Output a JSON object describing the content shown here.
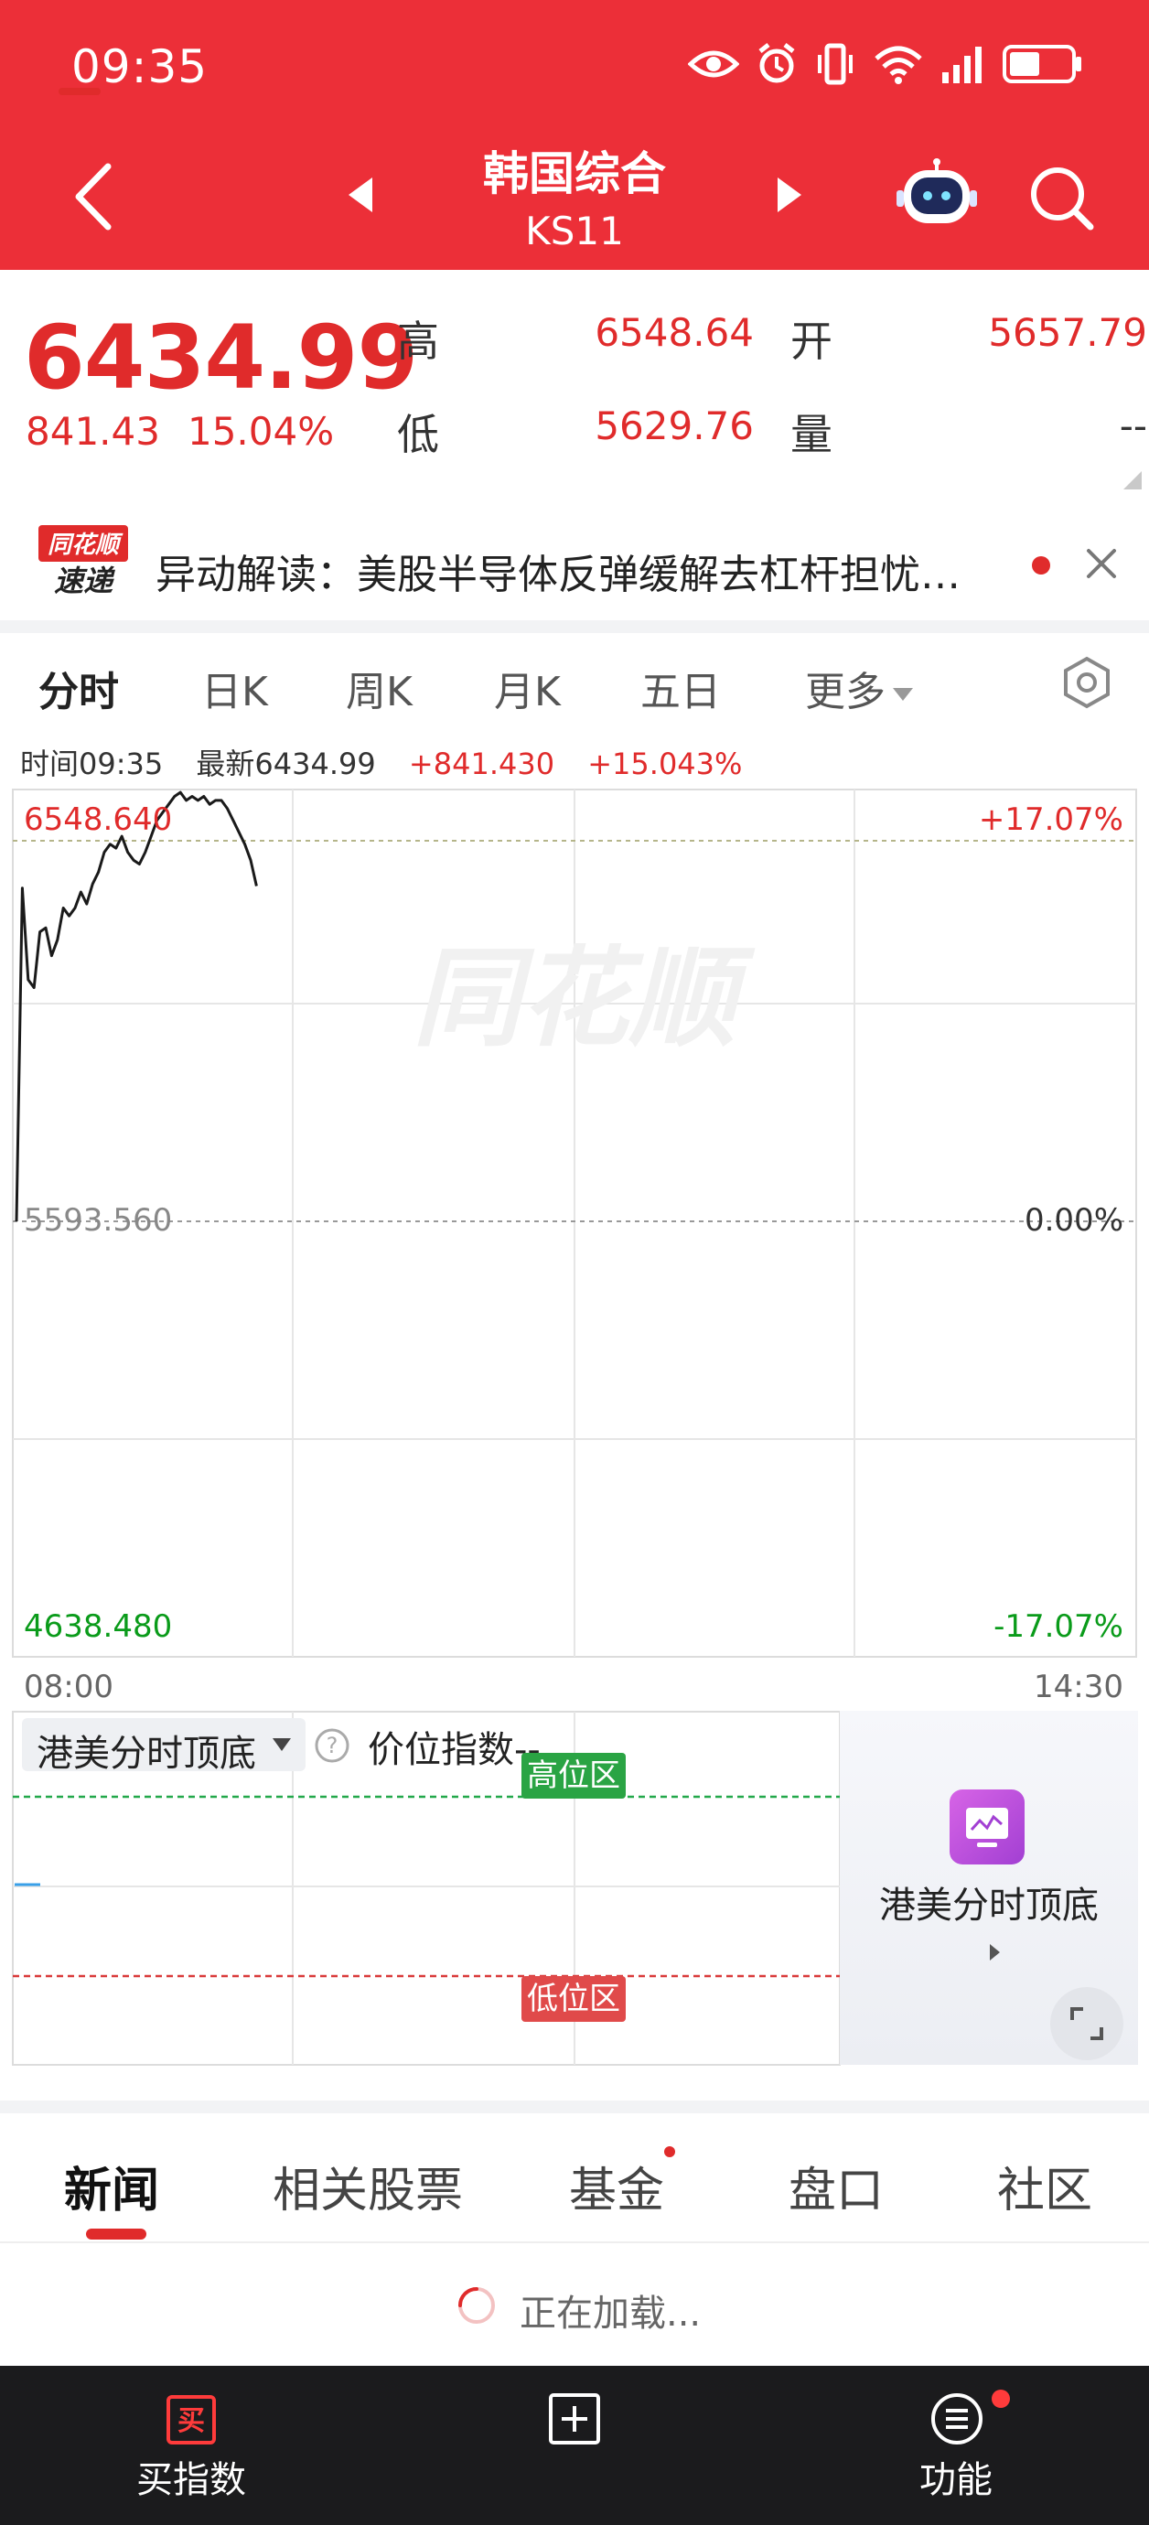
{
  "status_bar": {
    "time": "09:35",
    "battery_level": 0.5
  },
  "header": {
    "title": "韩国综合",
    "code": "KS11"
  },
  "quote": {
    "price": "6434.99",
    "change": "841.43",
    "change_pct": "15.04%",
    "high_label": "高",
    "high": "6548.64",
    "open_label": "开",
    "open": "5657.79",
    "low_label": "低",
    "low": "5629.76",
    "volume_label": "量",
    "volume": "--",
    "colors": {
      "up": "#e02b2b",
      "down": "#0a9b1a",
      "brand": "#ec2f38"
    }
  },
  "ticker": {
    "logo_top": "同花顺",
    "logo_bottom": "速递",
    "text": "异动解读：美股半导体反弹缓解去杠杆担忧…"
  },
  "chart_tabs": [
    "分时",
    "日K",
    "周K",
    "月K",
    "五日",
    "更多"
  ],
  "chart_info": {
    "time_label": "时间",
    "time": "09:35",
    "latest_label": "最新",
    "latest": "6434.99",
    "change": "+841.430",
    "change_pct": "+15.043%"
  },
  "chart_data": {
    "type": "line",
    "series": [
      {
        "values": [
          5593.56,
          6430.0,
          6200.0,
          6180.0,
          6320.0,
          6330.0,
          6260.0,
          6300.0,
          6380.0,
          6360.0,
          6380.0,
          6420.0,
          6390.0,
          6440.0,
          6470.0,
          6520.0,
          6540.0,
          6530.0,
          6560.0,
          6520.0,
          6500.0,
          6490.0,
          6520.0,
          6560.0,
          6600.0,
          6620.0,
          6640.0,
          6660.0,
          6670.0,
          6650.0,
          6660.0,
          6650.0,
          6660.0,
          6640.0,
          6650.0,
          6650.0,
          6630.0,
          6600.0,
          6570.0,
          6540.0,
          6500.0,
          6434.99
        ]
      }
    ],
    "y_left_ticks": [
      "6548.640",
      "5593.560",
      "4638.480"
    ],
    "y_right_ticks": [
      "+17.07%",
      "0.00%",
      "-17.07%"
    ],
    "x_ticks": [
      "08:00",
      "14:30"
    ],
    "ylim": [
      4638.48,
      6548.64
    ],
    "reference_value": 5593.56,
    "grid": true,
    "watermark": "同花顺"
  },
  "indicator": {
    "selector": "港美分时顶底",
    "name": "价位指数",
    "value": "--",
    "high_zone": "高位区",
    "low_zone": "低位区",
    "promo_title": "港美分时顶底"
  },
  "lower_tabs": [
    "新闻",
    "相关股票",
    "基金",
    "盘口",
    "社区"
  ],
  "loading_text": "正在加载...",
  "bottom_bar": {
    "buy_icon_char": "买",
    "buy_label": "买指数",
    "function_label": "功能"
  }
}
